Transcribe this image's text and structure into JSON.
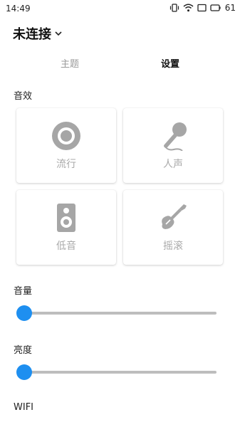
{
  "status_bar": {
    "time": "14:49",
    "battery": "61"
  },
  "header": {
    "title": "未连接"
  },
  "tabs": [
    {
      "label": "主题"
    },
    {
      "label": "设置"
    }
  ],
  "sound_effects": {
    "label": "音效",
    "items": [
      {
        "label": "流行",
        "icon": "speaker-disc-icon"
      },
      {
        "label": "人声",
        "icon": "microphone-icon"
      },
      {
        "label": "低音",
        "icon": "bass-speaker-icon"
      },
      {
        "label": "摇滚",
        "icon": "electric-guitar-icon"
      }
    ]
  },
  "volume": {
    "label": "音量",
    "value": 0
  },
  "brightness": {
    "label": "亮度",
    "value": 0
  },
  "wifi": {
    "label": "WIFI"
  },
  "colors": {
    "accent": "#1e8ff0",
    "icon_gray": "#a6a6a6",
    "track": "#bdbdbd"
  }
}
